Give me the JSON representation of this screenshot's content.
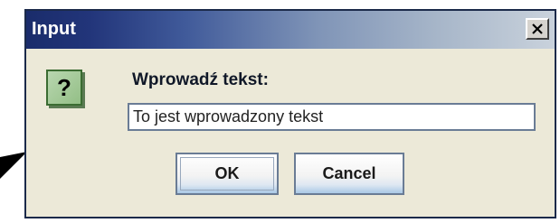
{
  "window": {
    "title": "Input",
    "close_icon": "close-icon"
  },
  "dialog": {
    "icon": "question-icon",
    "icon_glyph": "?",
    "prompt_label": "Wprowadź tekst:",
    "input_value": "To jest wprowadzony tekst"
  },
  "buttons": {
    "ok_label": "OK",
    "cancel_label": "Cancel"
  },
  "colors": {
    "titlebar_start": "#1a2c6b",
    "titlebar_end": "#c9d2dc",
    "dialog_bg": "#ece9d8",
    "icon_bg": "#93bf86"
  }
}
